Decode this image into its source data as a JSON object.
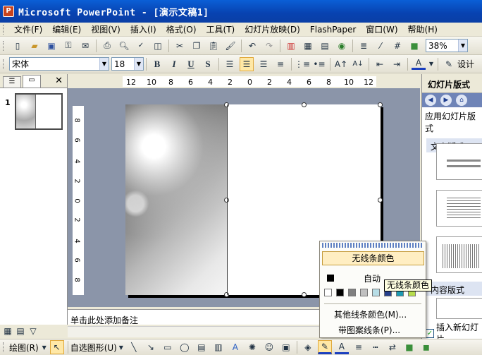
{
  "window": {
    "title": "Microsoft PowerPoint - [演示文稿1]"
  },
  "menu": [
    "文件(F)",
    "编辑(E)",
    "视图(V)",
    "插入(I)",
    "格式(O)",
    "工具(T)",
    "幻灯片放映(D)",
    "FlashPaper",
    "窗口(W)",
    "帮助(H)"
  ],
  "toolbar": {
    "zoom": "38%",
    "design_label": "设计"
  },
  "format": {
    "font_name": "宋体",
    "font_size": "18",
    "bold": "B",
    "italic": "I",
    "underline": "U",
    "shadow": "S"
  },
  "ruler_h": [
    "12",
    "10",
    "8",
    "6",
    "4",
    "2",
    "0",
    "2",
    "4",
    "6",
    "8",
    "10",
    "12"
  ],
  "ruler_v": [
    "8",
    "6",
    "4",
    "2",
    "0",
    "2",
    "4",
    "6",
    "8"
  ],
  "slides_pane": {
    "slide_number": "1"
  },
  "notes": {
    "placeholder": "单击此处添加备注"
  },
  "task_pane": {
    "title": "幻灯片版式",
    "apply_label": "应用幻灯片版式",
    "text_layouts": "文字版式",
    "content_layouts": "内容版式",
    "show_on_insert": "插入新幻灯片"
  },
  "line_color_menu": {
    "no_line": "无线条颜色",
    "automatic": "自动",
    "more_colors": "其他线条颜色(M)...",
    "patterned_lines": "带图案线条(P)...",
    "swatch_colors": [
      "#ffffff",
      "#000000",
      "#808080",
      "#c0c0c0",
      "#b7dde6",
      "#26408c",
      "#1d9ab2",
      "#b7dd4c"
    ]
  },
  "tooltip": "无线条颜色",
  "draw_toolbar": {
    "draw": "绘图(R)",
    "autoshapes": "自选图形(U)"
  }
}
